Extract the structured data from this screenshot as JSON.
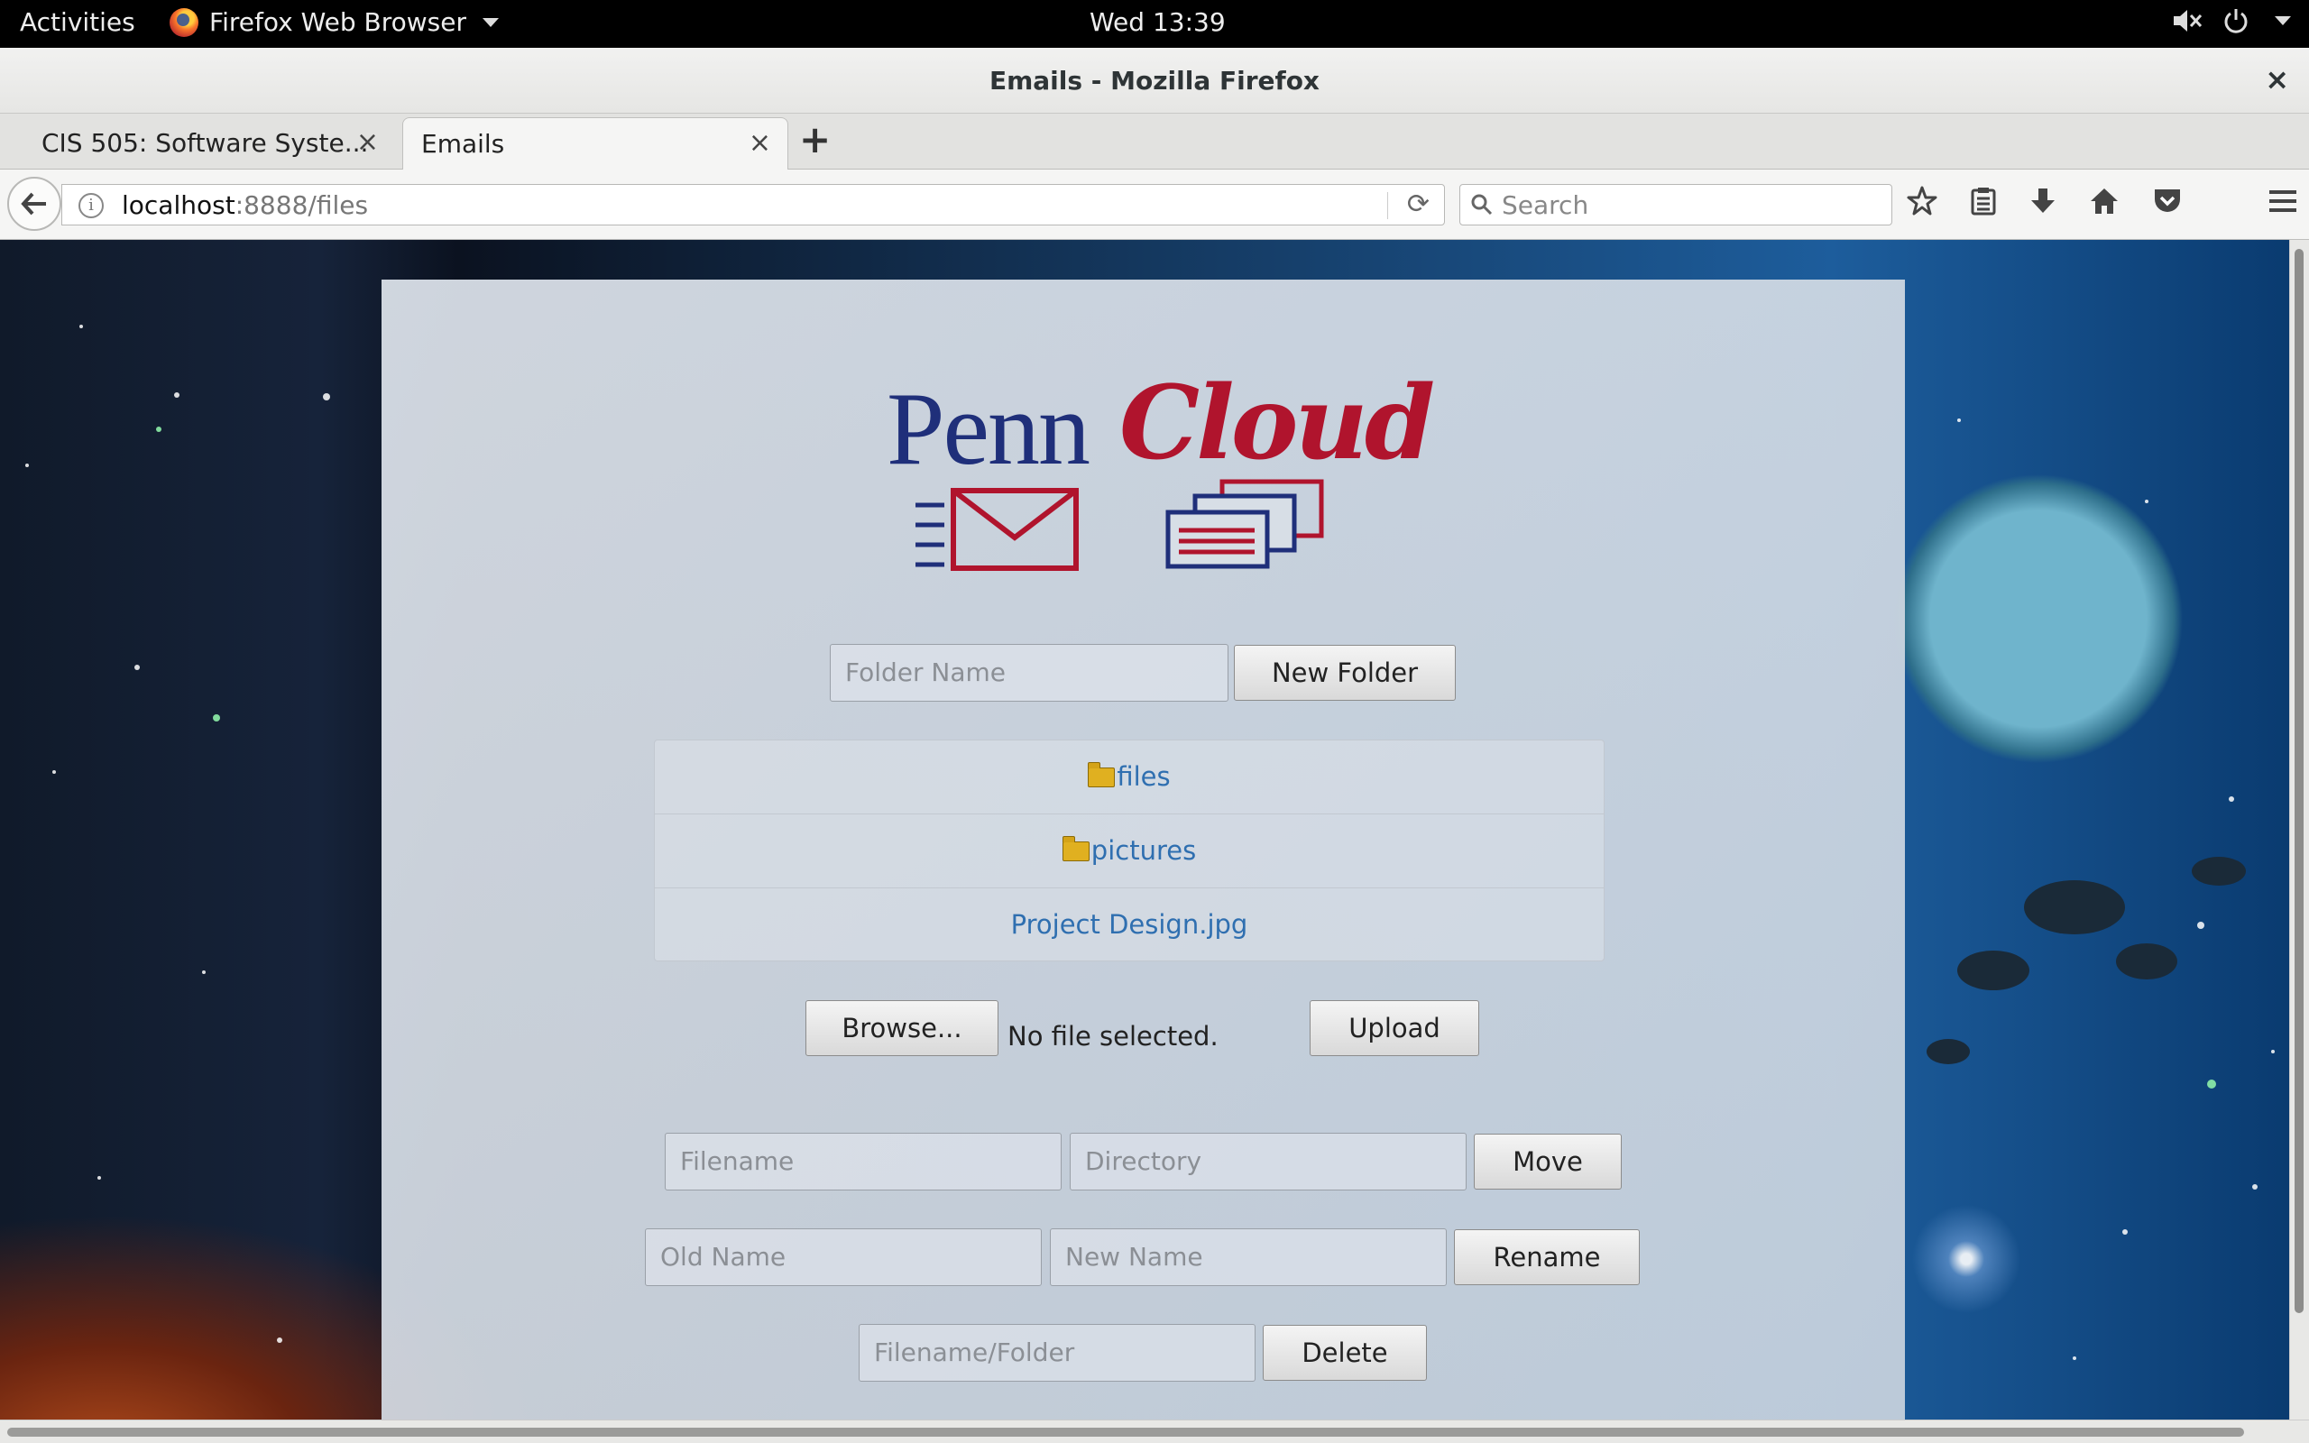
{
  "system_bar": {
    "activities": "Activities",
    "app_name": "Firefox Web Browser",
    "clock": "Wed 13:39"
  },
  "window": {
    "title": "Emails - Mozilla Firefox",
    "close_glyph": "×"
  },
  "tabs": [
    {
      "label": "CIS 505: Software Syste...",
      "active": false
    },
    {
      "label": "Emails",
      "active": true
    }
  ],
  "tab_close_glyph": "×",
  "new_tab_glyph": "+",
  "navbar": {
    "url_host": "localhost",
    "url_path": ":8888/files",
    "search_placeholder": "Search",
    "info_glyph": "i",
    "reload_glyph": "⟳"
  },
  "page": {
    "logo": {
      "penn": "Penn",
      "cloud": "Cloud"
    },
    "new_folder": {
      "placeholder": "Folder Name",
      "button": "New Folder"
    },
    "items": [
      {
        "name": "files",
        "type": "folder"
      },
      {
        "name": "pictures",
        "type": "folder"
      },
      {
        "name": "Project Design.jpg",
        "type": "file"
      }
    ],
    "upload": {
      "browse_button": "Browse...",
      "status": "No file selected.",
      "upload_button": "Upload"
    },
    "move": {
      "filename_placeholder": "Filename",
      "directory_placeholder": "Directory",
      "button": "Move"
    },
    "rename": {
      "old_placeholder": "Old Name",
      "new_placeholder": "New Name",
      "button": "Rename"
    },
    "delete": {
      "placeholder": "Filename/Folder",
      "button": "Delete"
    }
  },
  "colors": {
    "penn_blue": "#1f2f7a",
    "penn_red": "#b0142d",
    "link": "#2f6fb0"
  },
  "icons": [
    "firefox-icon",
    "speaker-muted-icon",
    "power-icon",
    "back-arrow-icon",
    "info-icon",
    "reload-icon",
    "search-icon",
    "bookmark-star-icon",
    "reading-list-icon",
    "download-icon",
    "home-icon",
    "pocket-icon",
    "hamburger-menu-icon",
    "mail-icon",
    "documents-icon",
    "folder-icon"
  ]
}
